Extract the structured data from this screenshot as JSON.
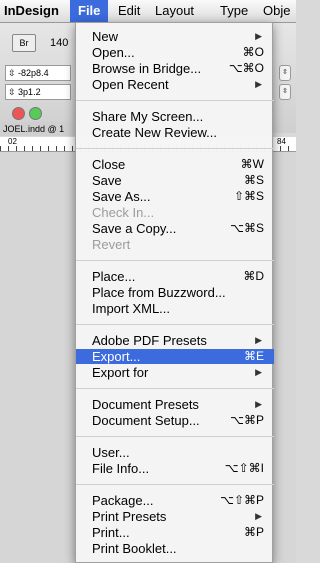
{
  "menubar": {
    "app": "InDesign",
    "items": [
      "File",
      "Edit",
      "Layout",
      "Type",
      "Obje"
    ]
  },
  "background": {
    "br_button": "Br",
    "zoom": "140",
    "ref_x": "-82p8.4",
    "ref_y": "3p1.2",
    "doc_tab": "JOEL.indd @ 1",
    "ruler_left": "02",
    "ruler_right": "84"
  },
  "file_menu": {
    "new": {
      "label": "New",
      "submenu": true
    },
    "open": {
      "label": "Open...",
      "shortcut": "⌘O"
    },
    "browse": {
      "label": "Browse in Bridge...",
      "shortcut": "⌥⌘O"
    },
    "open_recent": {
      "label": "Open Recent",
      "submenu": true
    },
    "share_screen": {
      "label": "Share My Screen..."
    },
    "create_review": {
      "label": "Create New Review..."
    },
    "close": {
      "label": "Close",
      "shortcut": "⌘W"
    },
    "save": {
      "label": "Save",
      "shortcut": "⌘S"
    },
    "save_as": {
      "label": "Save As...",
      "shortcut": "⇧⌘S"
    },
    "check_in": {
      "label": "Check In...",
      "disabled": true
    },
    "save_copy": {
      "label": "Save a Copy...",
      "shortcut": "⌥⌘S"
    },
    "revert": {
      "label": "Revert",
      "disabled": true
    },
    "place": {
      "label": "Place...",
      "shortcut": "⌘D"
    },
    "place_buzzword": {
      "label": "Place from Buzzword..."
    },
    "import_xml": {
      "label": "Import XML..."
    },
    "pdf_presets": {
      "label": "Adobe PDF Presets",
      "submenu": true
    },
    "export": {
      "label": "Export...",
      "shortcut": "⌘E",
      "highlighted": true
    },
    "export_for": {
      "label": "Export for",
      "submenu": true
    },
    "doc_presets": {
      "label": "Document Presets",
      "submenu": true
    },
    "doc_setup": {
      "label": "Document Setup...",
      "shortcut": "⌥⌘P"
    },
    "user": {
      "label": "User..."
    },
    "file_info": {
      "label": "File Info...",
      "shortcut": "⌥⇧⌘I"
    },
    "package": {
      "label": "Package...",
      "shortcut": "⌥⇧⌘P"
    },
    "print_presets": {
      "label": "Print Presets",
      "submenu": true
    },
    "print": {
      "label": "Print...",
      "shortcut": "⌘P"
    },
    "print_booklet": {
      "label": "Print Booklet..."
    }
  },
  "icons": {
    "submenu_arrow": "▶"
  },
  "colors": {
    "highlight": "#3b6bdc",
    "disabled_text": "#9c9c9c"
  }
}
